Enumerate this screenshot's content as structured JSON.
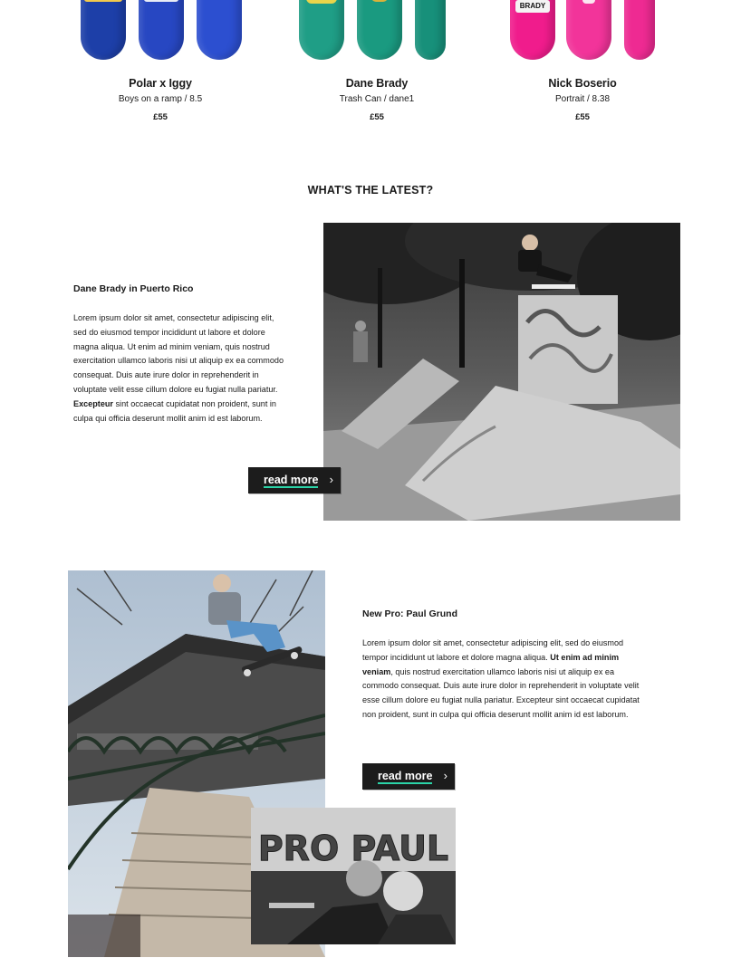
{
  "products": [
    {
      "name": "Polar x Iggy",
      "variant": "Boys on a ramp / 8.5",
      "price": "£55",
      "deck_colors": [
        "#1d3fa8",
        "#2747c2",
        "#2c4fd0"
      ],
      "deck_art": [
        "",
        "",
        ""
      ]
    },
    {
      "name": "Dane Brady",
      "variant": "Trash Can / dane1",
      "price": "£55",
      "deck_colors": [
        "#1f9e86",
        "#1a9a80",
        "#17907a"
      ],
      "deck_art": [
        "",
        "",
        ""
      ]
    },
    {
      "name": "Nick Boserio",
      "variant": "Portrait / 8.38",
      "price": "£55",
      "deck_colors": [
        "#f01c8c",
        "#f2349a",
        "#ee2a92"
      ],
      "deck_art": [
        "BRADY",
        "",
        ""
      ]
    }
  ],
  "latest": {
    "heading": "WHAT'S THE LATEST?",
    "articles": [
      {
        "title": "Dane Brady in Puerto Rico",
        "body_parts": [
          "Lorem ipsum dolor sit amet, consectetur adipiscing elit, sed do eiusmod tempor incididunt ut labore et dolore magna aliqua. Ut enim ad minim veniam, quis nostrud exercitation ullamco laboris nisi ut aliquip ex ea commodo consequat. Duis aute irure dolor in reprehenderit in voluptate velit esse cillum dolore eu fugiat nulla pariatur. ",
          "Excepteur",
          " sint occaecat cupidatat non proident, sunt in culpa qui officia deserunt mollit anim id est laborum."
        ],
        "cta": "read more"
      },
      {
        "title": "New Pro: Paul Grund",
        "body_parts": [
          "Lorem ipsum dolor sit amet, consectetur adipiscing elit, sed do eiusmod tempor incididunt ut labore et dolore magna aliqua. ",
          "Ut enim ad minim veniam",
          ", quis nostrud exercitation ullamco laboris nisi ut aliquip ex ea commodo consequat. Duis aute irure dolor in reprehenderit in voluptate velit esse cillum dolore eu fugiat nulla pariatur. Excepteur sint occaecat cupidatat non proident, sunt in culpa qui officia deserunt mollit anim id est laborum."
        ],
        "cta": "read more",
        "inset_photo_text": "PRO PAUL"
      }
    ]
  },
  "icons": {
    "read_more": "chevron-right-icon"
  },
  "colors": {
    "cta_bg": "#1c1c1c",
    "cta_underline": "#2bd4a8"
  }
}
